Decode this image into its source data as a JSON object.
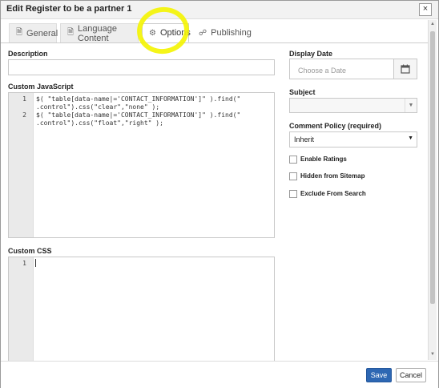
{
  "dialog": {
    "title": "Edit Register to be a partner 1",
    "close_glyph": "×"
  },
  "tabs": [
    {
      "label": "General",
      "icon": "page-icon"
    },
    {
      "label": "Language Content",
      "icon": "page-icon"
    },
    {
      "label": "Options",
      "icon": "gear-icon"
    },
    {
      "label": "Publishing",
      "icon": "share-icon"
    }
  ],
  "left": {
    "description_label": "Description",
    "description_value": "",
    "js_label": "Custom JavaScript",
    "js_lines": [
      {
        "num": "1",
        "a": "$( \"table[data-name|='CONTACT_INFORMATION']\" ).find(\"",
        "b": ".control\").css(\"clear\",\"none\" );"
      },
      {
        "num": "2",
        "a": "$( \"table[data-name|='CONTACT_INFORMATION']\" ).find(\"",
        "b": ".control\").css(\"float\",\"right\" );"
      }
    ],
    "css_label": "Custom CSS",
    "css_line": "1"
  },
  "right": {
    "display_date_label": "Display Date",
    "date_placeholder": "Choose a Date",
    "subject_label": "Subject",
    "subject_value": "",
    "comment_label": "Comment Policy (required)",
    "comment_value": "Inherit",
    "checkboxes": [
      "Enable Ratings",
      "Hidden from Sitemap",
      "Exclude From Search"
    ]
  },
  "footer": {
    "save": "Save",
    "cancel": "Cancel"
  },
  "colors": {
    "accent": "#2d67b3",
    "highlight": "#f4f400"
  }
}
